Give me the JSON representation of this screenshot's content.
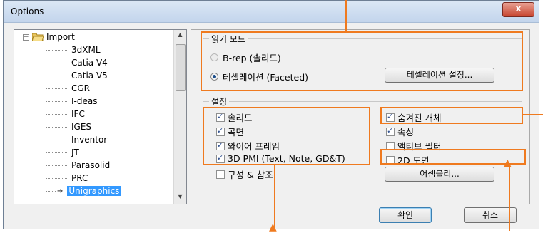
{
  "window": {
    "title": "Options",
    "close_glyph": "x"
  },
  "tree": {
    "root": {
      "label": "Import",
      "expander": "−"
    },
    "items": [
      {
        "label": "3dXML"
      },
      {
        "label": "Catia V4"
      },
      {
        "label": "Catia V5"
      },
      {
        "label": "CGR"
      },
      {
        "label": "I-deas"
      },
      {
        "label": "IFC"
      },
      {
        "label": "IGES"
      },
      {
        "label": "Inventor"
      },
      {
        "label": "JT"
      },
      {
        "label": "Parasolid"
      },
      {
        "label": "PRC"
      },
      {
        "label": "Unigraphics",
        "selected": true
      }
    ],
    "scroll": {
      "up": "▲",
      "down": "▼"
    }
  },
  "read_mode": {
    "title": "읽기 모드",
    "brep_label": "B-rep (솔리드)",
    "faceted_label": "테셀레이션 (Faceted)",
    "settings_button": "테셀레이션 설정..."
  },
  "settings": {
    "title": "설정",
    "left": [
      {
        "label": "솔리드",
        "checked": true
      },
      {
        "label": "곡면",
        "checked": true
      },
      {
        "label": "와이어 프레임",
        "checked": true
      },
      {
        "label": "3D PMI (Text, Note, GD&T)",
        "checked": true
      },
      {
        "label": "구성 & 참조",
        "checked": false
      }
    ],
    "right": [
      {
        "label": "숨겨진 개체",
        "checked": true
      },
      {
        "label": "속성",
        "checked": true
      },
      {
        "label": "액티브 필터",
        "checked": false
      },
      {
        "label": "2D 도면",
        "checked": false
      }
    ],
    "assembly_button": "어셈블리..."
  },
  "footer": {
    "ok": "확인",
    "cancel": "취소"
  },
  "colors": {
    "highlight": "#ef7a1f",
    "selection": "#3399ff"
  }
}
